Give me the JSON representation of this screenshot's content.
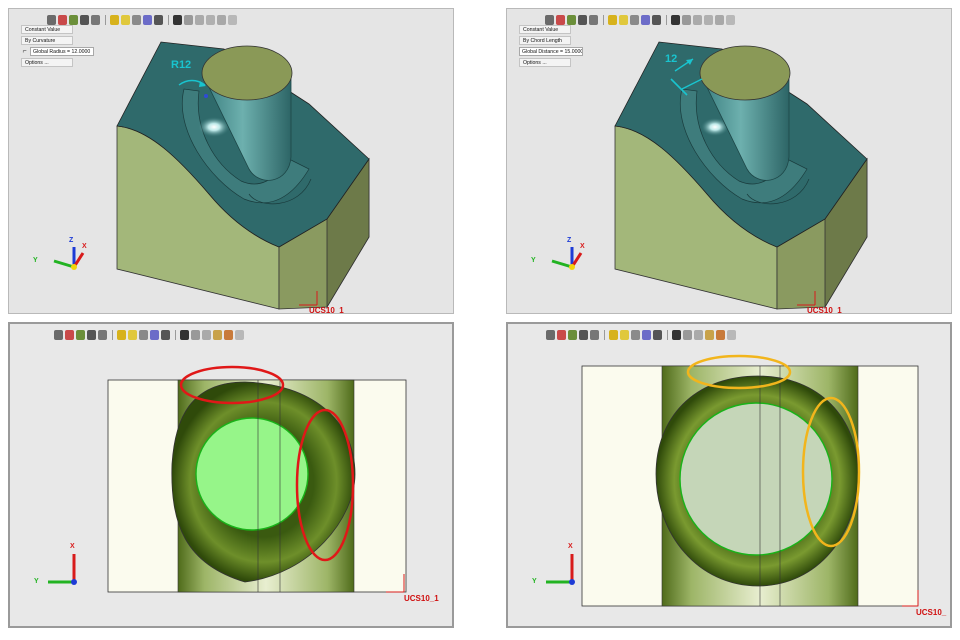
{
  "toolbar_icons": [
    "select-icon",
    "view-icon",
    "display-icon",
    "render-icon",
    "measure-icon",
    "light-icon",
    "shade-icon",
    "color-icon",
    "rotate-icon",
    "zoom-icon",
    "pan-icon",
    "snap-icon"
  ],
  "panel_top_left": {
    "menu": {
      "option1": "Constant Value",
      "option2": "By Curvature",
      "parameter": "Global Radius = 12.0000",
      "options_button": "Options ..."
    },
    "dimension_label": "R12",
    "axis": {
      "z": "Z",
      "y": "Y",
      "x": "X"
    },
    "ucs_label": "UCS10_1"
  },
  "panel_top_right": {
    "menu": {
      "option1": "Constant Value",
      "option2": "By Chord Length",
      "parameter": "Global Distance = 15.0000",
      "options_button": "Options ..."
    },
    "dimension_label": "12",
    "axis": {
      "z": "Z",
      "y": "Y",
      "x": "X"
    },
    "ucs_label": "UCS10_1"
  },
  "panel_bottom_left": {
    "axis": {
      "x": "X",
      "y": "Y"
    },
    "ucs_label": "UCS10_1",
    "highlight_color": "#e01818"
  },
  "panel_bottom_right": {
    "axis": {
      "x": "X",
      "y": "Y"
    },
    "ucs_label": "UCS10_",
    "highlight_color": "#f2b51c"
  },
  "colors": {
    "teal_face": "#2f6a6b",
    "olive_face": "#a3b77a",
    "plate": "#fbfbee",
    "green_fill": "#96f589",
    "grey_fill": "#c5d6b8"
  }
}
